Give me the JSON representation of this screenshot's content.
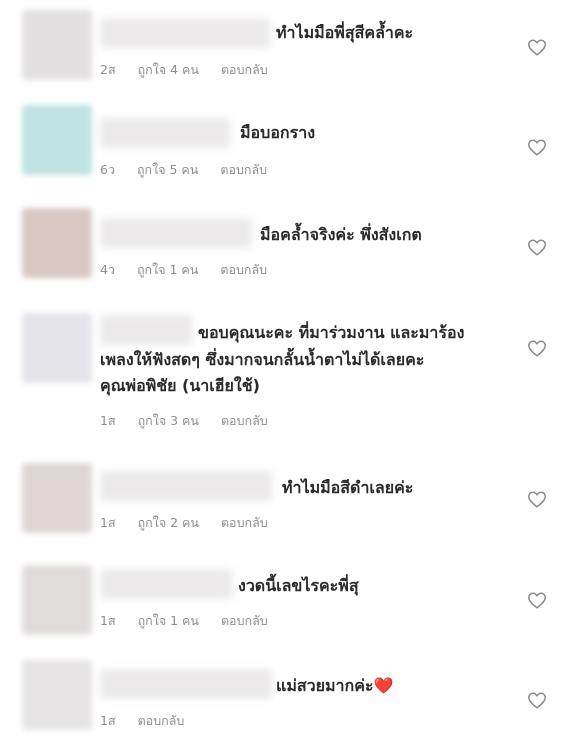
{
  "comments": [
    {
      "text": "ทำไมมือพี่สุสีคล้ำคะ",
      "time": "2ส",
      "likes": "ถูกใจ 4 คน",
      "reply": "ตอบกลับ",
      "avatar_color": "#e2e0e0"
    },
    {
      "text": "มือบอกราง",
      "time": "6ว",
      "likes": "ถูกใจ 5 คน",
      "reply": "ตอบกลับ",
      "avatar_color": "#bfe3e3"
    },
    {
      "text": "มือคล้ำจริงค่ะ พึ่งสังเกต",
      "time": "4ว",
      "likes": "ถูกใจ 1 คน",
      "reply": "ตอบกลับ",
      "avatar_color": "#d9c8c2"
    },
    {
      "text_lines": [
        "ขอบคุณนะคะ ที่มาร่วมงาน และมาร้อง",
        "เพลงให้ฟังสดๆ ซึ่งมากจนกลั้นน้ำตาไม่ได้เลยคะ",
        "คุณพ่อพิชัย (นาเฮียใช้)"
      ],
      "time": "1ส",
      "likes": "ถูกใจ 3 คน",
      "reply": "ตอบกลับ",
      "avatar_color": "#e4e4ea"
    },
    {
      "text": "ทำไมมือสีดำเลยค่ะ",
      "time": "1ส",
      "likes": "ถูกใจ 2 คน",
      "reply": "ตอบกลับ",
      "avatar_color": "#ddd6d4"
    },
    {
      "text": "งวดนี้เลขไรคะพี่สุ",
      "time": "1ส",
      "likes": "ถูกใจ 1 คน",
      "reply": "ตอบกลับ",
      "avatar_color": "#e0dcdc"
    },
    {
      "text": "แม่สวยมากค่ะ",
      "emoji": "❤️",
      "time": "1ส",
      "reply": "ตอบกลับ",
      "avatar_color": "#e6e4e4"
    }
  ],
  "icons": {
    "like": "heart-outline-icon"
  },
  "colors": {
    "meta": "#8e8e8e",
    "text": "#2a2a2a",
    "emoji_heart": "#e0202a"
  }
}
